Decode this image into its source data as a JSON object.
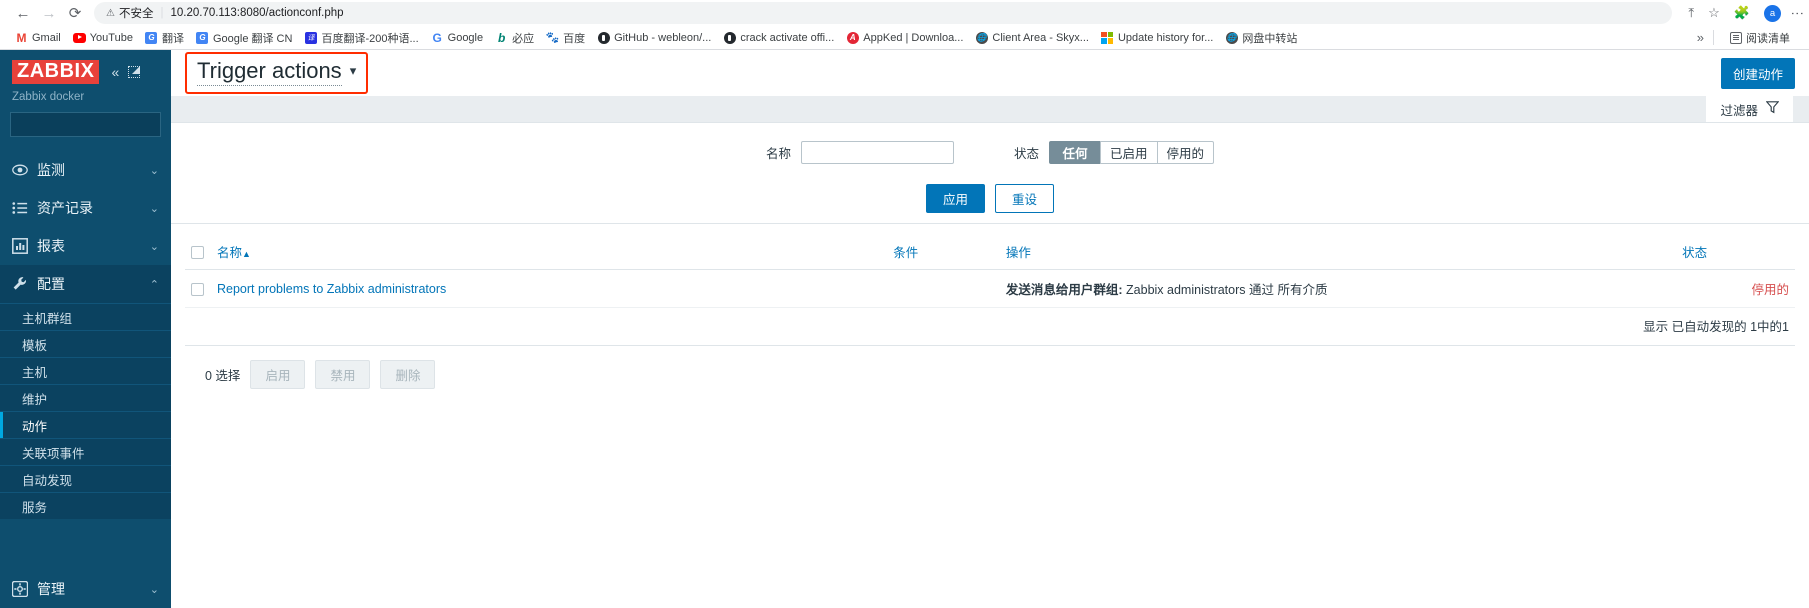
{
  "browser": {
    "nav": {
      "back_icon": "back-arrow-icon",
      "forward_icon": "forward-arrow-icon",
      "reload_icon": "reload-icon"
    },
    "omnibox": {
      "security_icon": "warning-triangle-icon",
      "security_label": "不安全",
      "url": "10.20.70.113:8080/actionconf.php"
    },
    "toolbar": {
      "share_icon": "share-icon",
      "bookmark_icon": "star-icon",
      "extensions_icon": "puzzle-icon",
      "profile_initial": "a",
      "menu_icon": "kebab-menu-icon"
    },
    "bookmarks": [
      {
        "label": "Gmail",
        "icon": "gmail-icon"
      },
      {
        "label": "YouTube",
        "icon": "youtube-icon"
      },
      {
        "label": "翻译",
        "icon": "google-translate-icon"
      },
      {
        "label": "Google 翻译 CN",
        "icon": "google-translate-icon"
      },
      {
        "label": "百度翻译-200种语...",
        "icon": "baidu-translate-icon"
      },
      {
        "label": "Google",
        "icon": "google-icon"
      },
      {
        "label": "必应",
        "icon": "bing-icon"
      },
      {
        "label": "百度",
        "icon": "baidu-icon"
      },
      {
        "label": "GitHub - webleon/...",
        "icon": "github-icon"
      },
      {
        "label": "crack activate offi...",
        "icon": "github-icon"
      },
      {
        "label": "AppKed | Downloa...",
        "icon": "appked-icon"
      },
      {
        "label": "Client Area - Skyx...",
        "icon": "globe-icon"
      },
      {
        "label": "Update history for...",
        "icon": "microsoft-icon"
      },
      {
        "label": "网盘中转站",
        "icon": "globe-icon"
      }
    ],
    "bookmarks_overflow_icon": "chevron-double-right-icon",
    "reading_list": {
      "label": "阅读清单",
      "icon": "reading-list-icon"
    }
  },
  "sidebar": {
    "logo_text": "ZABBIX",
    "collapse_icon": "chevron-double-left-icon",
    "pin_icon": "collapse-panel-icon",
    "server_name": "Zabbix docker",
    "search": {
      "value": "",
      "placeholder": "",
      "icon": "search-icon"
    },
    "menu": [
      {
        "label": "监测",
        "icon": "eye-icon",
        "arrow": "⌄",
        "active": false
      },
      {
        "label": "资产记录",
        "icon": "list-icon",
        "arrow": "⌄",
        "active": false
      },
      {
        "label": "报表",
        "icon": "chart-bar-icon",
        "arrow": "⌄",
        "active": false
      },
      {
        "label": "配置",
        "icon": "wrench-icon",
        "arrow": "⌃",
        "active": true
      }
    ],
    "submenu": [
      {
        "label": "主机群组",
        "current": false
      },
      {
        "label": "模板",
        "current": false
      },
      {
        "label": "主机",
        "current": false
      },
      {
        "label": "维护",
        "current": false
      },
      {
        "label": "动作",
        "current": true
      },
      {
        "label": "关联项事件",
        "current": false
      },
      {
        "label": "自动发现",
        "current": false
      },
      {
        "label": "服务",
        "current": false
      }
    ],
    "bottom_menu": [
      {
        "label": "管理",
        "icon": "gear-icon",
        "arrow": "⌄"
      }
    ]
  },
  "page": {
    "title": "Trigger actions",
    "title_chevron_icon": "chevron-down-icon",
    "create_button": "创建动作",
    "filter_tab": {
      "label": "过滤器",
      "icon": "funnel-icon"
    }
  },
  "filter": {
    "name_label": "名称",
    "name_value": "",
    "name_placeholder": "",
    "status_label": "状态",
    "status_options": [
      {
        "label": "任何",
        "selected": true
      },
      {
        "label": "已启用",
        "selected": false
      },
      {
        "label": "停用的",
        "selected": false
      }
    ],
    "apply_button": "应用",
    "reset_button": "重设"
  },
  "table": {
    "columns": [
      "名称",
      "条件",
      "操作",
      "状态"
    ],
    "sort_indicator": "▲",
    "rows": [
      {
        "name": "Report problems to Zabbix administrators",
        "conditions": "",
        "operation_prefix": "发送消息给用户群组:",
        "operation_target": "Zabbix administrators",
        "operation_middle": "通过",
        "operation_media": "所有介质",
        "status": "停用的"
      }
    ],
    "paging_text": "显示 已自动发现的 1中的1"
  },
  "footer": {
    "selected_text": "0 选择",
    "buttons": [
      "启用",
      "禁用",
      "删除"
    ]
  },
  "colors": {
    "accent_blue": "#0275b8",
    "brand_red": "#e8413a",
    "sidebar_bg": "#0e4e6e",
    "highlight_red": "#ff2d00",
    "status_disabled": "#d64e4e"
  }
}
